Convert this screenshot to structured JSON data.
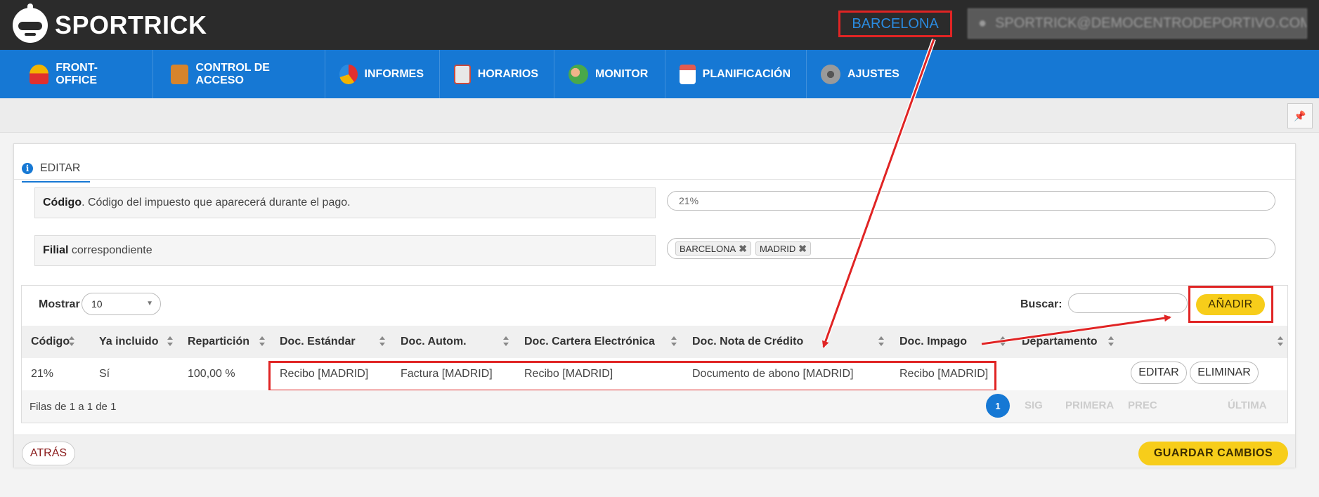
{
  "brand": {
    "name": "SPORTRICK"
  },
  "header": {
    "branch": "BARCELONA",
    "user": "SPORTRICK@DEMOCENTRODEPORTIVO.COM"
  },
  "nav": [
    {
      "label": "FRONT-OFFICE",
      "icon": "person-icon",
      "color": "#f3b400"
    },
    {
      "label": "CONTROL DE ACCESO",
      "icon": "turnstile-icon",
      "color": "#d6842c"
    },
    {
      "label": "INFORMES",
      "icon": "pie-chart-icon",
      "color": "#e0302e"
    },
    {
      "label": "HORARIOS",
      "icon": "calendar-grid-icon",
      "color": "#e8e8e8"
    },
    {
      "label": "MONITOR",
      "icon": "users-icon",
      "color": "#49a84a"
    },
    {
      "label": "PLANIFICACIÓN",
      "icon": "calendar-icon",
      "color": "#e35b4f"
    },
    {
      "label": "AJUSTES",
      "icon": "gear-icon",
      "color": "#9a9a9a"
    }
  ],
  "tab": {
    "label": "EDITAR"
  },
  "form": {
    "codigo": {
      "label_bold": "Código",
      "label_rest": ". Código del impuesto que aparecerá durante el pago.",
      "value": "21%"
    },
    "filial": {
      "label_bold": "Filial",
      "label_rest": " correspondiente",
      "tags": [
        "BARCELONA",
        "MADRID"
      ],
      "remove_glyph": "✖"
    }
  },
  "table_controls": {
    "show_label": "Mostrar",
    "show_value": "10",
    "search_label": "Buscar:",
    "search_value": "",
    "add_label": "AÑADIR"
  },
  "table": {
    "columns": [
      "Código",
      "Ya incluido",
      "Repartición",
      "Doc. Estándar",
      "Doc. Autom.",
      "Doc. Cartera Electrónica",
      "Doc. Nota de Crédito",
      "Doc. Impago",
      "Departamento"
    ],
    "rows": [
      {
        "codigo": "21%",
        "incluido": "Sí",
        "reparticion": "100,00 %",
        "estandar": "Recibo [MADRID]",
        "autom": "Factura [MADRID]",
        "cartera": "Recibo [MADRID]",
        "nota": "Documento de abono [MADRID]",
        "impago": "Recibo [MADRID]",
        "departamento": ""
      }
    ],
    "row_actions": {
      "edit": "EDITAR",
      "delete": "ELIMINAR"
    },
    "info": "Filas de 1 a 1 de 1",
    "pager": {
      "first": "PRIMERA",
      "prev": "PREC",
      "current": "1",
      "next": "SIG",
      "last": "ÚLTIMA"
    }
  },
  "footer": {
    "back": "ATRÁS",
    "save": "GUARDAR CAMBIOS"
  },
  "colors": {
    "accent": "#1678d4",
    "annotation": "#e02424",
    "button": "#f7cd1a"
  }
}
